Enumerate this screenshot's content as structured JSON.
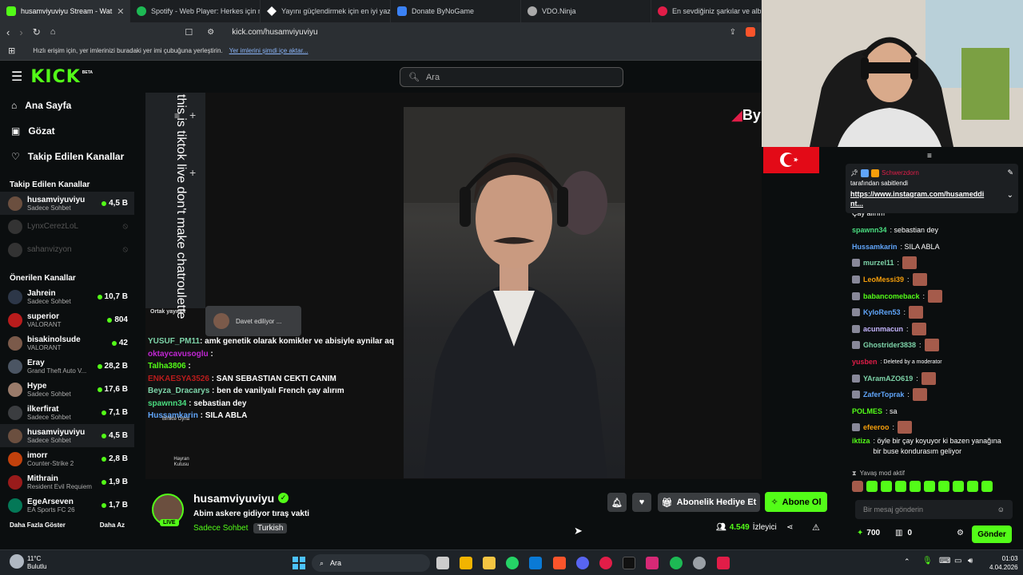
{
  "browser": {
    "tabs": [
      {
        "title": "husamviyuviyu Stream - Wat",
        "color": "#53fc18"
      },
      {
        "title": "Spotify - Web Player: Herkes için mü",
        "color": "#1db954"
      },
      {
        "title": "Yayını güçlendirmek için en iyi yazı",
        "color": "#ffffff"
      },
      {
        "title": "Donate ByNoGame",
        "color": "#3b82f6"
      },
      {
        "title": "VDO.Ninja",
        "color": "#aaaaaa"
      },
      {
        "title": "En sevdiğiniz şarkılar ve albümle",
        "color": "#e11d48"
      }
    ],
    "url": "kick.com/husamviyuviyu",
    "bookmarks_hint": "Hızlı erişim için, yer imlerinizi buradaki yer imi çubuğuna yerleştirin.",
    "bookmarks_link": "Yer imlerini şimdi içe aktar..."
  },
  "header": {
    "logo": "KICK",
    "beta": "BETA",
    "search_placeholder": "Ara"
  },
  "sidebar": {
    "nav": [
      {
        "label": "Ana Sayfa",
        "icon": "home-icon"
      },
      {
        "label": "Gözat",
        "icon": "browse-icon"
      },
      {
        "label": "Takip Edilen Kanallar",
        "icon": "heart-icon"
      }
    ],
    "following_title": "Takip Edilen Kanallar",
    "following": [
      {
        "name": "husamviyuviyu",
        "category": "Sadece Sohbet",
        "viewers": "4,5 B",
        "live": true
      },
      {
        "name": "LynxCerezLoL",
        "category": "",
        "viewers": "",
        "live": false
      },
      {
        "name": "sahanvizyon",
        "category": "",
        "viewers": "",
        "live": false
      }
    ],
    "recommended_title": "Önerilen Kanallar",
    "recommended": [
      {
        "name": "Jahrein",
        "category": "Sadece Sohbet",
        "viewers": "10,7 B"
      },
      {
        "name": "superior",
        "category": "VALORANT",
        "viewers": "804"
      },
      {
        "name": "bisakinolsude",
        "category": "VALORANT",
        "viewers": "42"
      },
      {
        "name": "Eray",
        "category": "Grand Theft Auto V...",
        "viewers": "28,2 B"
      },
      {
        "name": "Hype",
        "category": "Sadece Sohbet",
        "viewers": "17,6 B"
      },
      {
        "name": "ilkerfirat",
        "category": "Sadece Sohbet",
        "viewers": "7,1 B"
      },
      {
        "name": "husamviyuviyu",
        "category": "Sadece Sohbet",
        "viewers": "4,5 B"
      },
      {
        "name": "imorr",
        "category": "Counter-Strike 2",
        "viewers": "2,8 B"
      },
      {
        "name": "Mithrain",
        "category": "Resident Evil Requiem",
        "viewers": "1,9 B"
      },
      {
        "name": "EgeArseven",
        "category": "EA Sports FC 26",
        "viewers": "1,7 B"
      }
    ],
    "show_more": "Daha Fazla Göster",
    "show_less": "Daha Az"
  },
  "video": {
    "vertical_text": "this is tiktok live don't make chatroulette",
    "cohost_label": "Ortak yayıncı",
    "invite_text": "Davet ediliyor ...",
    "together_label": "Birlikte Oyna",
    "fanbox_label": "Hayran Kutusu",
    "overlay_chat": [
      {
        "user": "YUSUF_PM11",
        "color": "#7dd3a8",
        "text": ": amk genetik olarak komikler ve abisiyle aynilar aq"
      },
      {
        "user": "oktaycavusoglu",
        "color": "#c026d3",
        "text": " :"
      },
      {
        "user": "Talha3806",
        "color": "#53fc18",
        "text": " :"
      },
      {
        "user": "ENKAESYA3526",
        "color": "#b91c1c",
        "text": " : SAN SEBASTIAN CEKTI CANIM"
      },
      {
        "user": "Beyza_Dracarys",
        "color": "#7dd3a8",
        "text": " : ben de vanilyalı French çay alırım"
      },
      {
        "user": "spawnn34",
        "color": "#4ade80",
        "text": " : sebastian dey"
      },
      {
        "user": "Hussamkarin",
        "color": "#60a5fa",
        "text": " : SILA ABLA"
      }
    ]
  },
  "stream_info": {
    "channel": "husamviyuviyu",
    "title": "Abim askere gidiyor tıraş vakti",
    "category": "Sadece Sohbet",
    "tag": "Turkish",
    "live_badge": "LIVE",
    "gift_button": "Abonelik Hediye Et",
    "subscribe_button": "Abone Ol",
    "viewers": "4.549",
    "viewers_label": "İzleyici"
  },
  "chat": {
    "pinned_by": "Schwerzdorn",
    "pinned_label": "tarafından sabitlendi",
    "pinned_link": "https://www.instagram.com/husameddi nt...",
    "partial_top": "Çay alırım",
    "messages": [
      {
        "user": "spawnn34",
        "color": "#4ade80",
        "text": ": sebastian dey"
      },
      {
        "user": "Hussamkarin",
        "color": "#60a5fa",
        "text": ": SILA ABLA"
      },
      {
        "user": "murzel11",
        "color": "#7dd3a8",
        "text": ":",
        "emote": true
      },
      {
        "user": "LeoMessi39",
        "color": "#f59e0b",
        "text": ":",
        "emote": true
      },
      {
        "user": "babancomeback",
        "color": "#53fc18",
        "text": ":",
        "emote": true
      },
      {
        "user": "KyloRen53",
        "color": "#60a5fa",
        "text": ":",
        "emote": true
      },
      {
        "user": "acunmacun",
        "color": "#c4b5fd",
        "text": ":",
        "emote": true
      },
      {
        "user": "Ghostrider3838",
        "color": "#7dd3a8",
        "text": ":",
        "emote": true
      },
      {
        "user": "yusben",
        "color": "#e11d48",
        "text": ": Deleted by a moderator"
      },
      {
        "user": "YAramAZO619",
        "color": "#7dd3a8",
        "text": ":",
        "emote": true
      },
      {
        "user": "ZaferToprak",
        "color": "#60a5fa",
        "text": ":",
        "emote": true
      },
      {
        "user": "POLMES",
        "color": "#53fc18",
        "text": ": sa"
      },
      {
        "user": "efeeroo",
        "color": "#f59e0b",
        "text": ":",
        "emote": true
      },
      {
        "user": "iktiza",
        "color": "#53fc18",
        "text": ": öyle bir çay koyuyor ki bazen yanağına bir buse kondurasım geliyor"
      }
    ],
    "slow_mode": "Yavaş mod aktif",
    "input_placeholder": "Bir mesaj gönderin",
    "points": "700",
    "other_count": "0",
    "send_button": "Gönder"
  },
  "taskbar": {
    "weather_temp": "11°C",
    "weather_desc": "Bulutlu",
    "search": "Ara",
    "time": "01:03",
    "date": "4.04.2026"
  }
}
